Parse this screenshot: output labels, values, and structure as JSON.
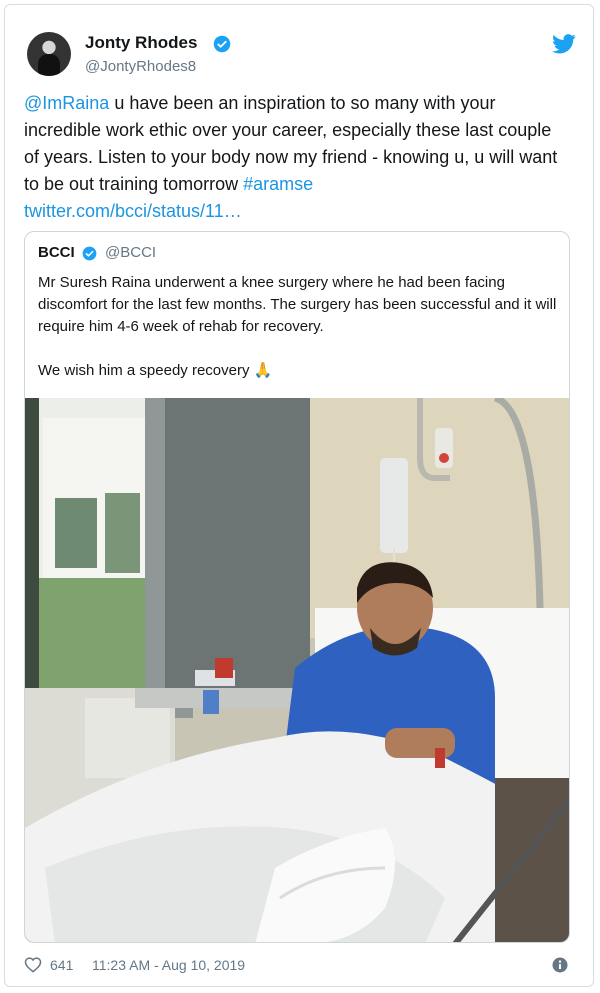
{
  "author": {
    "name": "Jonty Rhodes",
    "handle": "@JontyRhodes8"
  },
  "tweet": {
    "mention": "@ImRaina",
    "body": " u have been an inspiration to so many with your incredible work ethic over your career, especially these last couple of years. Listen to your body now my friend - knowing u, u will want to be out training tomorrow ",
    "hashtag": "#aramse",
    "link": "twitter.com/bcci/status/11…"
  },
  "quoted": {
    "name": "BCCI",
    "handle": "@BCCI",
    "para1": "Mr Suresh Raina underwent a knee surgery where he had been facing discomfort for the last few months. The surgery has been successful and it will require him 4-6 week of rehab for recovery.",
    "para2": "We wish him a speedy recovery 🙏"
  },
  "footer": {
    "likes": "641",
    "timestamp": "11:23 AM - Aug 10, 2019"
  },
  "colors": {
    "link": "#1b95e0",
    "verified": "#1da1f2",
    "muted": "#657786"
  },
  "icons": [
    "verified-badge-icon",
    "twitter-bird-icon",
    "heart-icon",
    "info-icon"
  ]
}
